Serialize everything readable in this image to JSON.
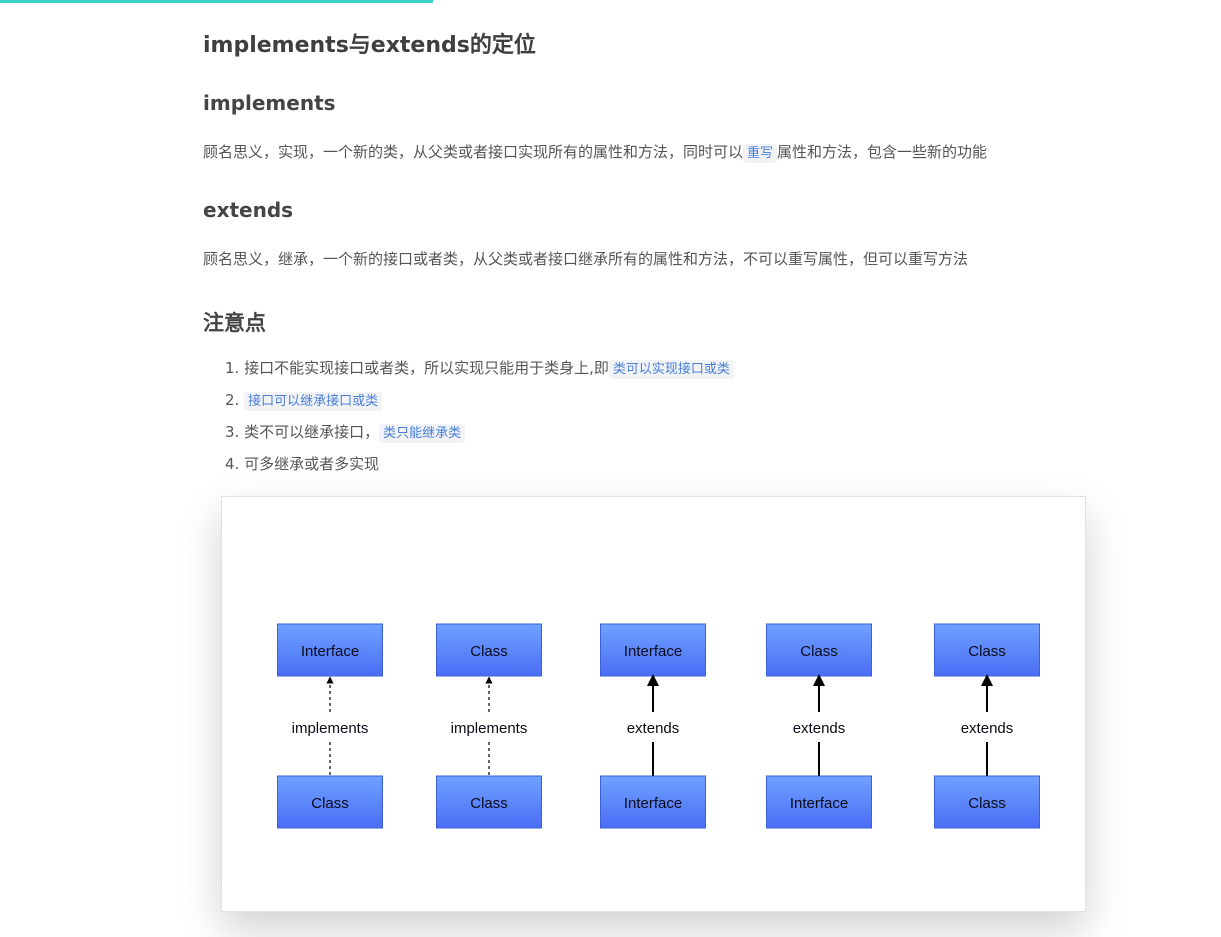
{
  "title": "implements与extends的定位",
  "implements": {
    "heading": "implements",
    "text_before": "顾名思义，实现，一个新的类，从父类或者接口实现所有的属性和方法，同时可以",
    "code": "重写",
    "text_after": "属性和方法，包含一些新的功能"
  },
  "extends": {
    "heading": "extends",
    "text": "顾名思义，继承，一个新的接口或者类，从父类或者接口继承所有的属性和方法，不可以重写属性，但可以重写方法"
  },
  "notes": {
    "heading": "注意点",
    "items": [
      {
        "num": "1.",
        "text": "接口不能实现接口或者类，所以实现只能用于类身上,即",
        "code": "类可以实现接口或类"
      },
      {
        "num": "2.",
        "text": "",
        "code": "接口可以继承接口或类"
      },
      {
        "num": "3.",
        "text": "类不可以继承接口，",
        "code": "类只能继承类"
      },
      {
        "num": "4.",
        "text": "可多继承或者多实现",
        "code": ""
      }
    ]
  },
  "diagram": {
    "columns": [
      {
        "top": "Interface",
        "relation": "implements",
        "bottom": "Class",
        "style": "dashed"
      },
      {
        "top": "Class",
        "relation": "implements",
        "bottom": "Class",
        "style": "dashed"
      },
      {
        "top": "Interface",
        "relation": "extends",
        "bottom": "Interface",
        "style": "solid"
      },
      {
        "top": "Class",
        "relation": "extends",
        "bottom": "Interface",
        "style": "solid"
      },
      {
        "top": "Class",
        "relation": "extends",
        "bottom": "Class",
        "style": "solid"
      }
    ],
    "box_gradient_top": "#6fa2ff",
    "box_gradient_bottom": "#4a6ef5",
    "box_border": "#3c5fd8"
  },
  "colors": {
    "progress": "#3ad1c6",
    "code_text": "#4a7fd6",
    "code_bg": "#f1f3f7"
  }
}
